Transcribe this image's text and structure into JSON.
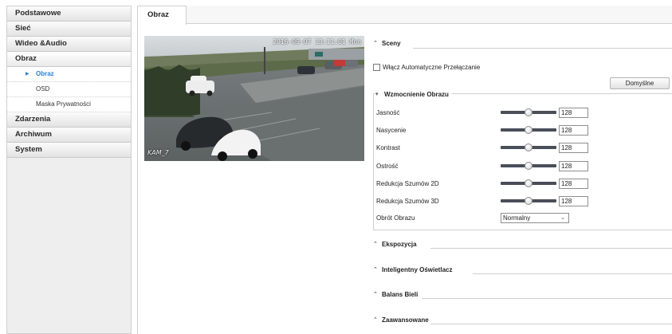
{
  "sidebar": {
    "groups": [
      {
        "label": "Podstawowe"
      },
      {
        "label": "Sieć"
      },
      {
        "label": "Wideo &Audio"
      },
      {
        "label": "Obraz"
      },
      {
        "label": "Zdarzenia"
      },
      {
        "label": "Archiwum"
      },
      {
        "label": "System"
      }
    ],
    "obraz_items": [
      {
        "label": "Obraz",
        "active": true
      },
      {
        "label": "OSD"
      },
      {
        "label": "Maska Prywatności"
      }
    ]
  },
  "tabs": [
    {
      "label": "Obraz",
      "active": true
    }
  ],
  "preview": {
    "timestamp": "2016-09-07 13:11:01 Mon",
    "camera_name": "KAM_7"
  },
  "sections": {
    "sceny": "Sceny",
    "auto_switch_label": "Włącz Automatyczne Przełączanie",
    "enhancement": "Wzmocnienie Obrazu",
    "ekspozycja": "Ekspozycja",
    "inteligentny": "Inteligentny Oświetlacz",
    "balans": "Balans Bieli",
    "zaawansowane": "Zaawansowane"
  },
  "buttons": {
    "default_label": "Domyślne"
  },
  "params": [
    {
      "label": "Jasność",
      "value": "128",
      "level": 0.5
    },
    {
      "label": "Nasycenie",
      "value": "128",
      "level": 0.5
    },
    {
      "label": "Kontrast",
      "value": "128",
      "level": 0.5
    },
    {
      "label": "Ostrość",
      "value": "128",
      "level": 0.5
    },
    {
      "label": "Redukcja Szumów 2D",
      "value": "128",
      "level": 0.5
    },
    {
      "label": "Redukcja Szumów 3D",
      "value": "128",
      "level": 0.5
    }
  ],
  "rotation": {
    "label": "Obrót Obrazu",
    "value": "Normalny"
  },
  "icons": {
    "expanded": "caret-down-icon",
    "collapsed": "caret-up-icon",
    "active_item": "triangle-right-icon",
    "select": "chevron-down-icon"
  }
}
